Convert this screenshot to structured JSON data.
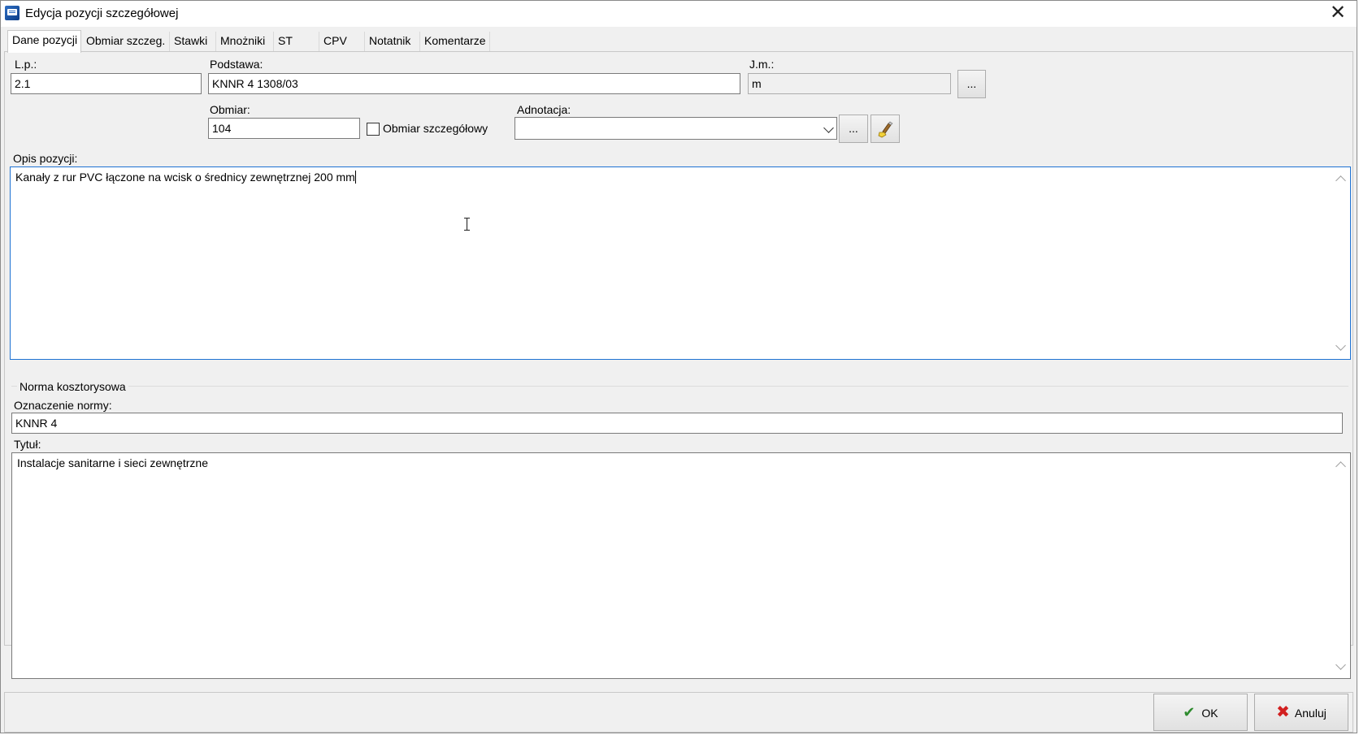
{
  "window": {
    "title": "Edycja pozycji szczegółowej",
    "close_glyph": "✕"
  },
  "tabs": [
    {
      "label": "Dane pozycji",
      "active": true
    },
    {
      "label": "Obmiar szczeg.",
      "active": false
    },
    {
      "label": "Stawki",
      "active": false
    },
    {
      "label": "Mnożniki",
      "active": false
    },
    {
      "label": "ST",
      "active": false
    },
    {
      "label": "CPV",
      "active": false
    },
    {
      "label": "Notatnik",
      "active": false
    },
    {
      "label": "Komentarze",
      "active": false
    }
  ],
  "form": {
    "lp_label": "L.p.:",
    "lp_value": "2.1",
    "podstawa_label": "Podstawa:",
    "podstawa_value": "KNNR 4 1308/03",
    "jm_label": "J.m.:",
    "jm_value": "m",
    "jm_button": "...",
    "obmiar_label": "Obmiar:",
    "obmiar_value": "104",
    "obmiar_szczeg_label": "Obmiar szczegółowy",
    "obmiar_szczeg_checked": false,
    "adnotacja_label": "Adnotacja:",
    "adnotacja_value": "",
    "adnotacja_button": "...",
    "clear_icon": "brush-icon",
    "opis_label": "Opis pozycji:",
    "opis_value": "Kanały z rur PVC łączone na wcisk o średnicy zewnętrznej 200 mm"
  },
  "norma": {
    "group_label": "Norma kosztorysowa",
    "oznaczenie_label": "Oznaczenie normy:",
    "oznaczenie_value": "KNNR 4",
    "tytul_label": "Tytuł:",
    "tytul_value": "Instalacje sanitarne i sieci zewnętrzne"
  },
  "buttons": {
    "ok_label": "OK",
    "ok_icon": "checkmark-icon",
    "ok_color": "#2e8b2e",
    "cancel_label": "Anuluj",
    "cancel_icon": "x-icon",
    "cancel_color": "#d22020"
  },
  "colors": {
    "focus_border": "#1e72d3",
    "dialog_bg": "#f0f0f0"
  }
}
